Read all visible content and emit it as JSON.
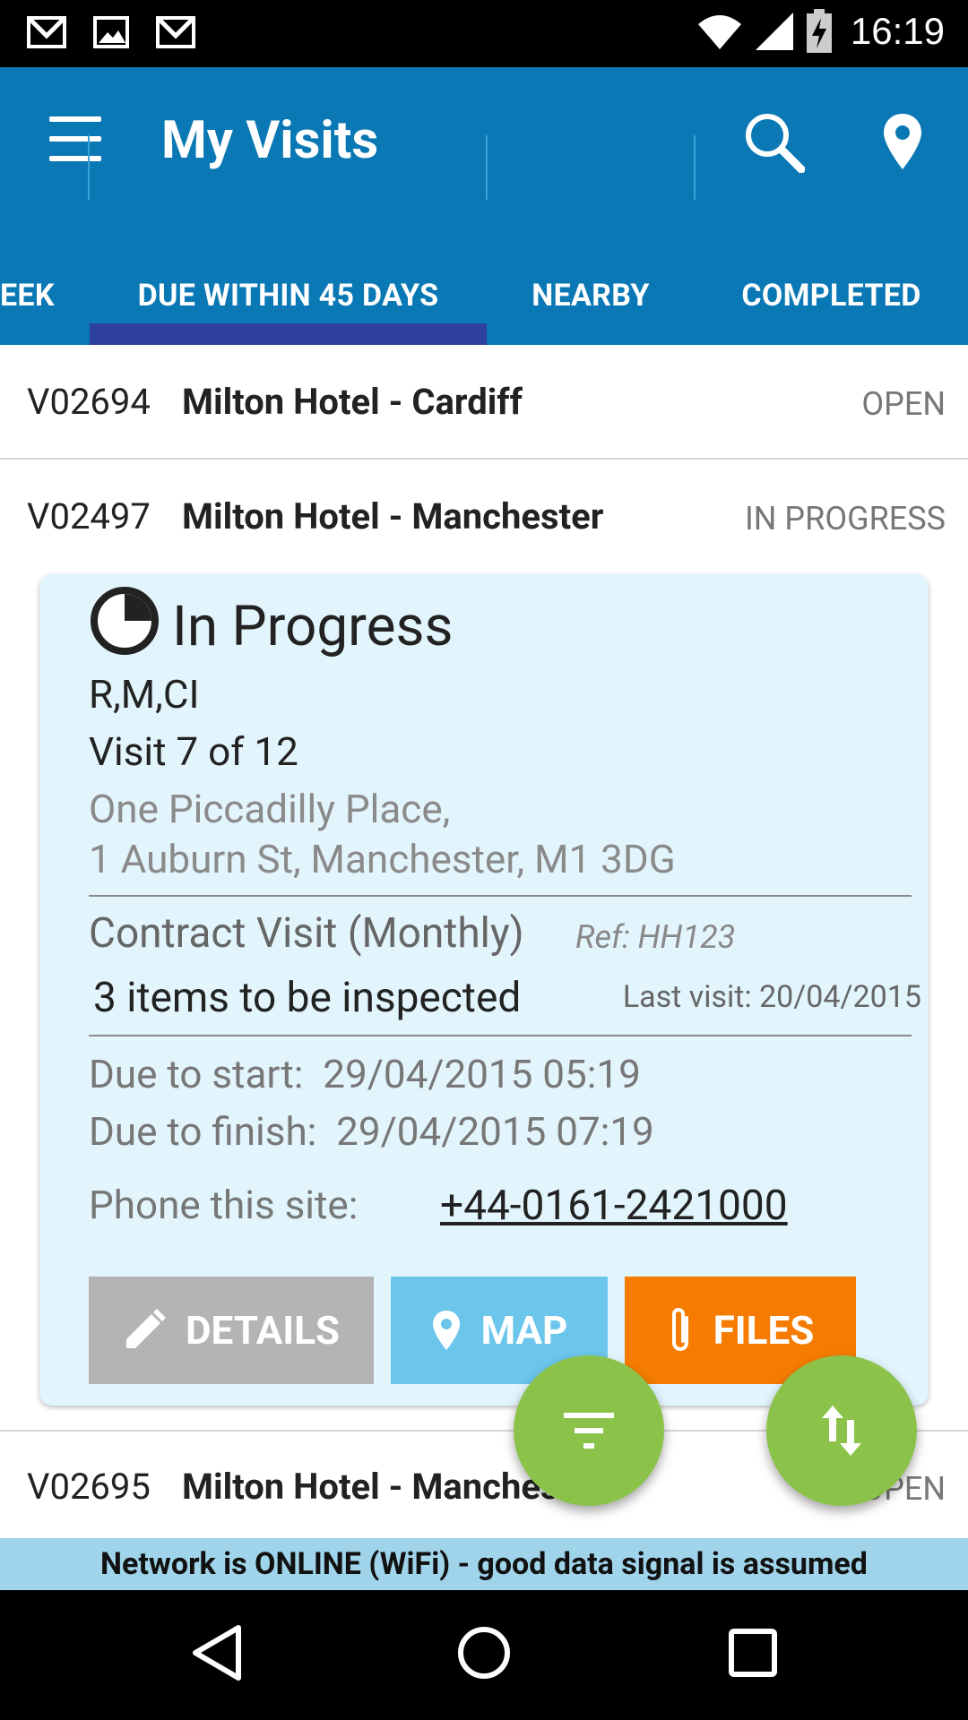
{
  "status_bar": {
    "time": "16:19",
    "icons": [
      "gmail-icon",
      "image-icon",
      "gmail-icon",
      "wifi-icon",
      "signal-icon",
      "battery-charging-icon"
    ]
  },
  "app_bar": {
    "title": "My Visits",
    "icons": [
      "menu-icon",
      "search-icon",
      "location-pin-icon"
    ]
  },
  "tabs": [
    {
      "label": "EEK"
    },
    {
      "label": "DUE WITHIN 45 DAYS",
      "selected": true
    },
    {
      "label": "NEARBY"
    },
    {
      "label": "COMPLETED"
    }
  ],
  "visits": [
    {
      "id": "V02694",
      "name": "Milton Hotel - Cardiff",
      "status": "OPEN"
    },
    {
      "id": "V02497",
      "name": "Milton Hotel - Manchester",
      "status": "IN PROGRESS"
    },
    {
      "id": "V02695",
      "name": "Milton Hotel - Manchester",
      "status": "OPEN"
    }
  ],
  "card": {
    "progress_title": "In Progress",
    "codes": "R,M,CI",
    "visit_count": "Visit 7 of 12",
    "address_line1": "One Piccadilly Place,",
    "address_line2": "1 Auburn St, Manchester, M1 3DG",
    "contract": "Contract Visit (Monthly)",
    "ref": "Ref: HH123",
    "items": "3 items to be inspected",
    "last_visit": "Last visit: 20/04/2015",
    "due_start": "Due to start:  29/04/2015 05:19",
    "due_finish": "Due to finish:  29/04/2015 07:19",
    "phone_label": "Phone this site:",
    "phone": "+44-0161-2421000",
    "buttons": {
      "details": "DETAILS",
      "map": "MAP",
      "files": "FILES"
    }
  },
  "network_banner": "Network is ONLINE (WiFi) - good data signal is assumed",
  "colors": {
    "app_bar": "#0a78b4",
    "tab_indicator": "#2e3fa0",
    "card_bg": "#e2f4fc",
    "details_btn": "#b4b4b4",
    "map_btn": "#6cc6ec",
    "files_btn": "#f57c00",
    "fab": "#8bc34a",
    "banner": "#9fd4ea"
  }
}
